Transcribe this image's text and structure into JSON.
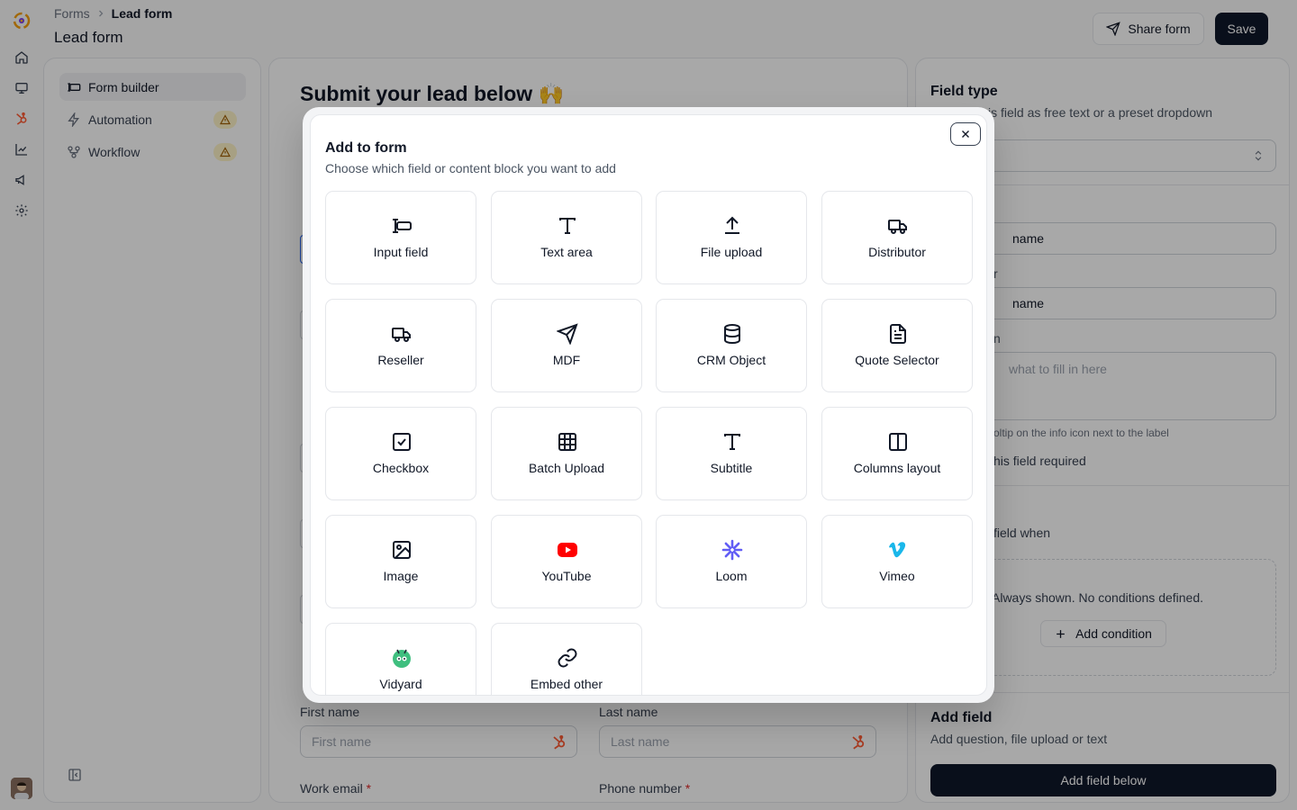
{
  "header": {
    "breadcrumb_root": "Forms",
    "breadcrumb_current": "Lead form",
    "page_title": "Lead form",
    "share_label": "Share form",
    "save_label": "Save"
  },
  "left_nav": {
    "items": [
      {
        "label": "Form builder",
        "icon": "form-builder-icon",
        "active": true
      },
      {
        "label": "Automation",
        "icon": "lightning-icon",
        "warning": true
      },
      {
        "label": "Workflow",
        "icon": "workflow-icon",
        "warning": true
      }
    ]
  },
  "form": {
    "heading": "Submit your lead below 🙌",
    "first_name_label": "First name",
    "first_name_placeholder": "First name",
    "last_name_label": "Last name",
    "last_name_placeholder": "Last name",
    "work_email_label": "Work email",
    "phone_label": "Phone number",
    "required_mark": "*"
  },
  "right_panel": {
    "field_type_title": "Field type",
    "field_type_desc": "is field as free text or a preset dropdown",
    "label_value": "name",
    "placeholder_label": "r",
    "placeholder_value": "name",
    "help_label": "n",
    "help_placeholder": "what to fill in here",
    "help_hint": "oltip on the info icon next to the label",
    "required_text": "his field required",
    "show_when_text": "field when",
    "conditions_empty": "Always shown. No conditions defined.",
    "add_condition": "Add condition",
    "add_field_title": "Add field",
    "add_field_desc": "Add question, file upload or text",
    "add_field_button": "Add field below"
  },
  "modal": {
    "title": "Add to form",
    "subtitle": "Choose which field or content block you want to add",
    "tiles": [
      {
        "label": "Input field",
        "icon": "input-field-icon"
      },
      {
        "label": "Text area",
        "icon": "text-icon"
      },
      {
        "label": "File upload",
        "icon": "upload-icon"
      },
      {
        "label": "Distributor",
        "icon": "truck-icon"
      },
      {
        "label": "Reseller",
        "icon": "truck-icon"
      },
      {
        "label": "MDF",
        "icon": "send-icon"
      },
      {
        "label": "CRM Object",
        "icon": "database-icon"
      },
      {
        "label": "Quote Selector",
        "icon": "document-icon"
      },
      {
        "label": "Checkbox",
        "icon": "checkbox-icon"
      },
      {
        "label": "Batch Upload",
        "icon": "table-icon"
      },
      {
        "label": "Subtitle",
        "icon": "text-icon"
      },
      {
        "label": "Columns layout",
        "icon": "columns-icon"
      },
      {
        "label": "Image",
        "icon": "image-icon"
      },
      {
        "label": "YouTube",
        "icon": "youtube-icon"
      },
      {
        "label": "Loom",
        "icon": "loom-icon"
      },
      {
        "label": "Vimeo",
        "icon": "vimeo-icon"
      },
      {
        "label": "Vidyard",
        "icon": "vidyard-icon"
      },
      {
        "label": "Embed other",
        "icon": "link-icon"
      }
    ]
  },
  "colors": {
    "primary_dark": "#0f172a",
    "hubspot": "#ff5c35",
    "youtube": "#ff0000",
    "loom": "#625df5",
    "vimeo": "#1ab7ea",
    "vidyard": "#3fbf7f",
    "warning_bg": "#fdf3c7"
  }
}
